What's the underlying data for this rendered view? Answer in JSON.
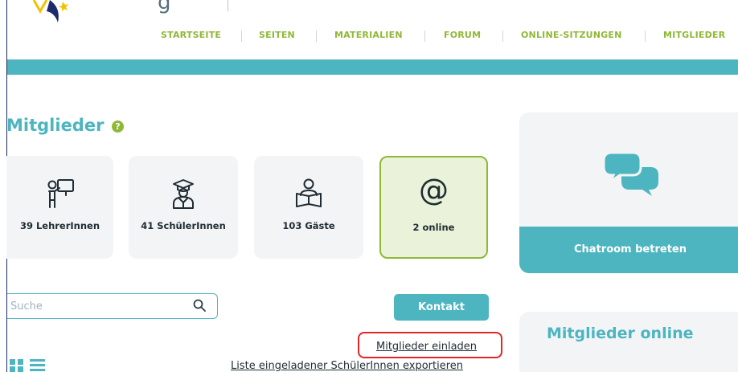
{
  "header": {
    "logo_text_fragment": "g",
    "nav": [
      {
        "label": "STARTSEITE"
      },
      {
        "label": "SEITEN"
      },
      {
        "label": "MATERIALIEN"
      },
      {
        "label": "FORUM"
      },
      {
        "label": "ONLINE-SITZUNGEN"
      },
      {
        "label": "MITGLIEDER"
      }
    ]
  },
  "page": {
    "title": "Mitglieder",
    "help_icon": "?"
  },
  "stats": [
    {
      "label": "39 LehrerInnen",
      "icon": "teacher-icon"
    },
    {
      "label": "41 SchülerInnen",
      "icon": "student-icon"
    },
    {
      "label": "103 Gäste",
      "icon": "guest-icon"
    },
    {
      "label": "2 online",
      "icon": "at-sign-icon",
      "symbol": "@"
    }
  ],
  "chat": {
    "button_label": "Chatroom betreten",
    "icon": "chat-bubbles-icon"
  },
  "search": {
    "placeholder": "Suche",
    "value": ""
  },
  "actions": {
    "contact_label": "Kontakt",
    "invite_label": "Mitglieder einladen",
    "export_label": "Liste eingeladener SchülerInnen exportieren"
  },
  "online_panel": {
    "title": "Mitglieder online"
  },
  "colors": {
    "accent_teal": "#4cb5c0",
    "accent_green": "#8fb837",
    "highlight_red": "#e0262b"
  }
}
